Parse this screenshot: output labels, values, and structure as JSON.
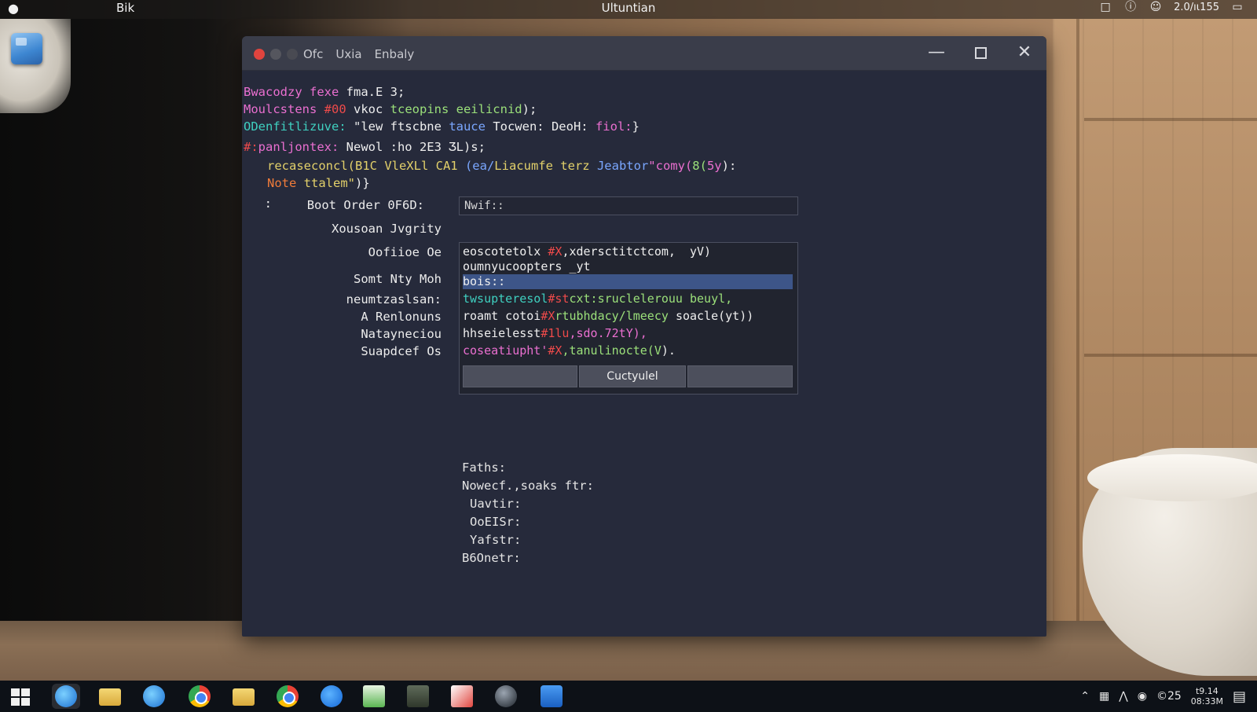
{
  "menubar": {
    "app_name": "Bik",
    "title": "Ultuntian",
    "status_text": "2.0/ıι155"
  },
  "window": {
    "menus": [
      "Ofc",
      "Uxia",
      "Enbaly"
    ],
    "controls": {
      "minimize": "—",
      "maximize": "□",
      "close": "✕"
    }
  },
  "code": {
    "l1": {
      "a": "Bwacodzy ",
      "b": "fexe ",
      "c": "fma.E 3;"
    },
    "l2": {
      "a": "Moulcstens ",
      "b": "#00 ",
      "c": "vkoc ",
      "d": "tceopins eeilicnid",
      "e": ");"
    },
    "l3": {
      "a": "ODenfitlizuve: ",
      "b": "\"lew ftscbne ",
      "c": "tauce ",
      "d": "Tocwen: DeoH: ",
      "e": "fiol:",
      "f": "}"
    },
    "l4": {
      "a": "#:",
      "b": "panljontex: ",
      "c": "Newol :ho 2E3 ӠL)s;"
    },
    "l5": {
      "a": "recaseconcl(",
      "b": "B1C",
      "c": " VleXLl CA1 ",
      "d": "(ea/",
      "e": "Liacumfe terz ",
      "f": "Jeabtor",
      "g": "\"comy(",
      "h": "8(",
      "i": "5y",
      "j": "):"
    },
    "l6": {
      "a": "Note ",
      "b": "ttalem\"",
      "c": ")}"
    }
  },
  "form": {
    "boot_order_label": "Boot Order 0F6D:",
    "boot_order_value": "Nwif::",
    "colon_marker": ":",
    "label_2": "Xousoan Jvgrity",
    "label_3": "Oofiioe Oe",
    "label_4": "Somt Nty Moh",
    "label_5": "neumtzaslsan:",
    "label_6": "A Renlonuns",
    "label_7": "Natayneciou",
    "label_8": "Suapdcef Os"
  },
  "panel": {
    "p1": {
      "a": "eoscotetolx ",
      "b": "#X",
      "c": ",",
      "d": "xdersctitctcom,  yV)"
    },
    "p2": "oumnyucoopters _yt",
    "p3": "bois::",
    "p4": {
      "a": "twsupteresol",
      "b": "#st",
      "c": "cxt:sruclelerouu beuyl,"
    },
    "p5": {
      "a": "roamt cotoi",
      "b": "#X",
      "c": "rtubhdacy/lmeecy ",
      "d": "soacle(yt))"
    },
    "p6": {
      "a": "hhseielesst",
      "b": "#1lu",
      "c": ",sdo.72tY),",
      "d": ""
    },
    "p7": {
      "a": "coseatiupht'",
      "b": "#X",
      "c": ",tanulinocte(V",
      "d": ")."
    },
    "buttons": [
      "",
      "Cuctyulel",
      ""
    ]
  },
  "paths": {
    "header": "Faths:",
    "item1": "Nowecf.,soaks ftr:",
    "item2": "Uavtir:",
    "item3": "OoEISr:",
    "item4": "Yafstr:",
    "item5": "B6Onetr:"
  },
  "taskbar": {
    "apps": [
      "internet-explorer",
      "file-explorer",
      "ie-globe",
      "chrome",
      "folder",
      "chrome",
      "messages",
      "spreadsheet",
      "terminal",
      "maps",
      "media-disc",
      "database"
    ],
    "tray_text": "©25",
    "clock_time": "t9.14",
    "clock_date": "08:33M"
  }
}
